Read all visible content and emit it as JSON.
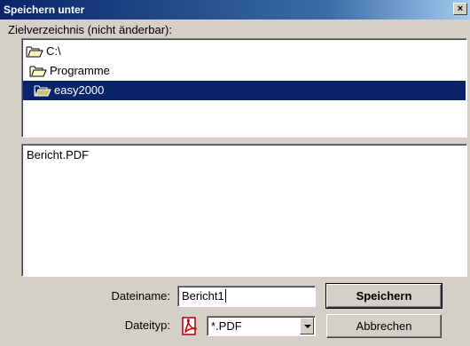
{
  "window": {
    "title": "Speichern unter",
    "close_glyph": "×"
  },
  "directory": {
    "label": "Zielverzeichnis (nicht änderbar):",
    "items": [
      {
        "label": "C:\\",
        "icon": "open-folder-icon"
      },
      {
        "label": "Programme",
        "icon": "open-folder-icon"
      },
      {
        "label": "easy2000",
        "icon": "open-folder-icon",
        "selected": true
      }
    ]
  },
  "files": {
    "items": [
      {
        "label": "Bericht.PDF"
      }
    ]
  },
  "form": {
    "filename_label": "Dateiname:",
    "filename_value": "Bericht1",
    "filetype_label": "Dateityp:",
    "filetype_value": "*.PDF",
    "filetype_icon": "pdf-icon"
  },
  "buttons": {
    "save_label": "Speichern",
    "cancel_label": "Abbrechen"
  },
  "colors": {
    "title_bar": "#0a246a",
    "selection": "#0a246a",
    "dialog_bg": "#d4d0c8"
  }
}
